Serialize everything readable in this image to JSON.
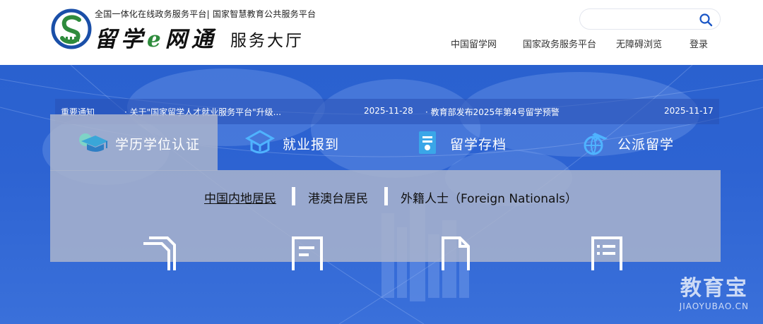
{
  "header": {
    "tagline": "全国一体化在线政务服务平台| 国家智慧教育公共服务平台",
    "logo_name_a": "留学",
    "logo_name_e": "e",
    "logo_name_b": "网通",
    "logo_sub": "服务大厅",
    "search": {
      "placeholder": "",
      "value": ""
    },
    "nav": [
      "中国留学网",
      "国家政务服务平台",
      "无障碍浏览",
      "登录"
    ]
  },
  "notice": {
    "label": "重要通知",
    "items": [
      {
        "title": "· 关于\"国家留学人才就业服务平台\"升级...",
        "date": "2025-11-28"
      },
      {
        "title": "· 教育部发布2025年第4号留学预警",
        "date": "2025-11-17"
      }
    ]
  },
  "tabs": [
    {
      "label": "学历学位认证",
      "icon": "graduation-cap-icon",
      "active": true
    },
    {
      "label": "就业报到",
      "icon": "briefcase-icon",
      "active": false
    },
    {
      "label": "留学存档",
      "icon": "archive-folder-icon",
      "active": false
    },
    {
      "label": "公派留学",
      "icon": "plane-globe-icon",
      "active": false
    }
  ],
  "subnav": [
    {
      "label": "中国内地居民",
      "active": true
    },
    {
      "label": "港澳台居民",
      "active": false
    },
    {
      "label": "外籍人士（Foreign Nationals）",
      "active": false
    }
  ],
  "panel_icons": [
    "documents-icon",
    "form-icon",
    "file-icon",
    "list-icon"
  ],
  "watermark": {
    "main": "教育宝",
    "sub": "JIAOYUBAO.CN"
  },
  "colors": {
    "banner": "#2d63d2",
    "accent_green": "#2e8b3c",
    "search_icon": "#1a56c6"
  }
}
